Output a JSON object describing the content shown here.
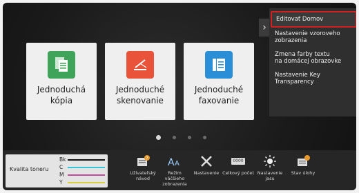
{
  "tiles": [
    {
      "label": "Jednoduchá\nkópia",
      "icon": "copy-icon",
      "color": "#3fa35a"
    },
    {
      "label": "Jednoduché\nskenovanie",
      "icon": "scanner-icon",
      "color": "#e8533a"
    },
    {
      "label": "Jednoduché\nfaxovanie",
      "icon": "fax-icon",
      "color": "#2a8fd6"
    }
  ],
  "pager": {
    "pages": 4,
    "active": 1
  },
  "menu": {
    "items": [
      "Editovať Domov",
      "Nastavenie vzoroveho\nzobrazenia",
      "Zmena farby textu\nna domácej obrazovke",
      "Nastavenie Key\nTransparency"
    ],
    "selected": 0
  },
  "toner": {
    "title": "Kvalita toneru",
    "channels": [
      {
        "name": "Bk",
        "color": "#111111"
      },
      {
        "name": "C",
        "color": "#34c6d6"
      },
      {
        "name": "M",
        "color": "#c04a9a"
      },
      {
        "name": "Y",
        "color": "#d9cf3c"
      }
    ]
  },
  "shortcuts": [
    {
      "label": "Užívateľský\nnávod",
      "icon": "manual-icon"
    },
    {
      "label": "Režim väčšieho\nzobrazenia",
      "icon": "large-text-icon"
    },
    {
      "label": "Nastavenie",
      "icon": "settings-tools-icon"
    },
    {
      "label": "Celkový počet",
      "icon": "counter-icon",
      "badge": "0000"
    },
    {
      "label": "Nastavenie\njasu",
      "icon": "brightness-icon"
    },
    {
      "label": "Stav úlohy",
      "icon": "job-status-icon"
    }
  ]
}
